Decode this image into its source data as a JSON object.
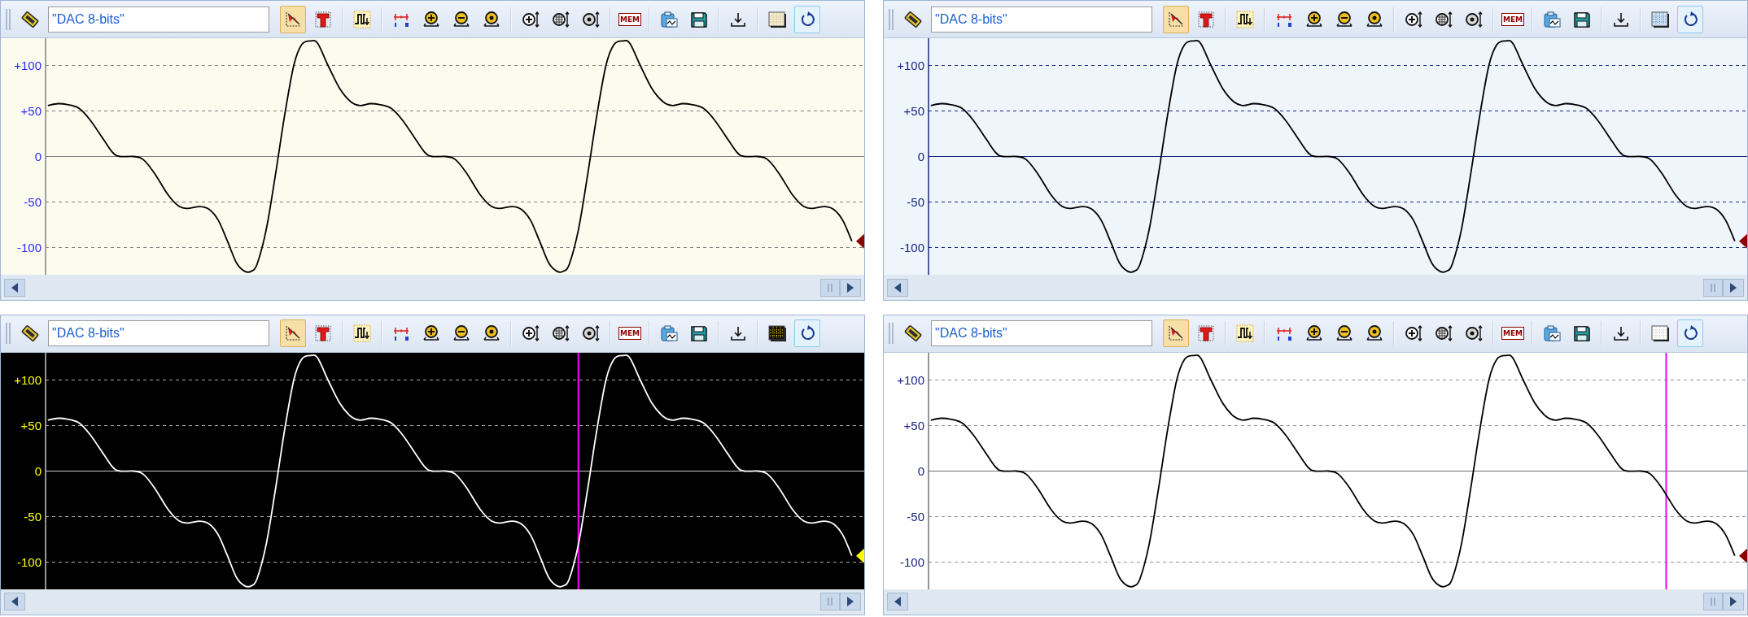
{
  "panels": [
    {
      "kind": "cream",
      "signal_name": "\"DAC 8-bits\"",
      "cursor": false,
      "y_labels": [
        "+100",
        "+50",
        "0",
        "-50",
        "-100"
      ],
      "toolbar": [
        {
          "kind": "trace",
          "pressed": true,
          "focused": false
        },
        {
          "kind": "text",
          "pressed": false,
          "focused": false
        },
        {
          "kind": "separator"
        },
        {
          "kind": "wave",
          "pressed": false,
          "focused": false
        },
        {
          "kind": "separator"
        },
        {
          "kind": "ruler",
          "pressed": false,
          "focused": false
        },
        {
          "kind": "zoom-in",
          "pressed": false,
          "focused": false
        },
        {
          "kind": "zoom-out",
          "pressed": false,
          "focused": false
        },
        {
          "kind": "zoom-fit",
          "pressed": false,
          "focused": false
        },
        {
          "kind": "separator"
        },
        {
          "kind": "vzoom-in",
          "pressed": false,
          "focused": false
        },
        {
          "kind": "vzoom-grid",
          "pressed": false,
          "focused": false
        },
        {
          "kind": "vzoom-fit",
          "pressed": false,
          "focused": false
        },
        {
          "kind": "separator"
        },
        {
          "kind": "memory",
          "label": "MEM",
          "pressed": false,
          "focused": false
        },
        {
          "kind": "separator"
        },
        {
          "kind": "clipboard",
          "pressed": false,
          "focused": false
        },
        {
          "kind": "save",
          "pressed": false,
          "focused": false
        },
        {
          "kind": "separator"
        },
        {
          "kind": "export",
          "pressed": false,
          "focused": false
        },
        {
          "kind": "separator"
        },
        {
          "kind": "grid",
          "pressed": false,
          "focused": false
        },
        {
          "kind": "reload",
          "pressed": false,
          "focused": true
        }
      ]
    },
    {
      "kind": "blue",
      "signal_name": "\"DAC 8-bits\"",
      "cursor": false,
      "y_labels": [
        "+100",
        "+50",
        "0",
        "-50",
        "-100"
      ],
      "toolbar": [
        {
          "kind": "trace",
          "pressed": true,
          "focused": false
        },
        {
          "kind": "text",
          "pressed": false,
          "focused": false
        },
        {
          "kind": "separator"
        },
        {
          "kind": "wave",
          "pressed": false,
          "focused": false
        },
        {
          "kind": "separator"
        },
        {
          "kind": "ruler",
          "pressed": false,
          "focused": false
        },
        {
          "kind": "zoom-in",
          "pressed": false,
          "focused": false
        },
        {
          "kind": "zoom-out",
          "pressed": false,
          "focused": false
        },
        {
          "kind": "zoom-fit",
          "pressed": false,
          "focused": false
        },
        {
          "kind": "separator"
        },
        {
          "kind": "vzoom-in",
          "pressed": false,
          "focused": false
        },
        {
          "kind": "vzoom-grid",
          "pressed": false,
          "focused": false
        },
        {
          "kind": "vzoom-fit",
          "pressed": false,
          "focused": false
        },
        {
          "kind": "separator"
        },
        {
          "kind": "memory",
          "label": "MEM",
          "pressed": false,
          "focused": false
        },
        {
          "kind": "separator"
        },
        {
          "kind": "clipboard",
          "pressed": false,
          "focused": false
        },
        {
          "kind": "save",
          "pressed": false,
          "focused": false
        },
        {
          "kind": "separator"
        },
        {
          "kind": "export",
          "pressed": false,
          "focused": false
        },
        {
          "kind": "separator"
        },
        {
          "kind": "grid",
          "pressed": false,
          "focused": false
        },
        {
          "kind": "reload",
          "pressed": false,
          "focused": true
        }
      ]
    },
    {
      "kind": "dark",
      "signal_name": "\"DAC 8-bits\"",
      "cursor": true,
      "y_labels": [
        "+100",
        "+50",
        "0",
        "-50",
        "-100"
      ],
      "toolbar": [
        {
          "kind": "trace",
          "pressed": true,
          "focused": false
        },
        {
          "kind": "text",
          "pressed": false,
          "focused": false
        },
        {
          "kind": "separator"
        },
        {
          "kind": "wave",
          "pressed": false,
          "focused": false
        },
        {
          "kind": "separator"
        },
        {
          "kind": "ruler",
          "pressed": false,
          "focused": false
        },
        {
          "kind": "zoom-in",
          "pressed": false,
          "focused": false
        },
        {
          "kind": "zoom-out",
          "pressed": false,
          "focused": false
        },
        {
          "kind": "zoom-fit",
          "pressed": false,
          "focused": false
        },
        {
          "kind": "separator"
        },
        {
          "kind": "vzoom-in",
          "pressed": false,
          "focused": false
        },
        {
          "kind": "vzoom-grid",
          "pressed": false,
          "focused": false
        },
        {
          "kind": "vzoom-fit",
          "pressed": false,
          "focused": false
        },
        {
          "kind": "separator"
        },
        {
          "kind": "memory",
          "label": "MEM",
          "pressed": false,
          "focused": false
        },
        {
          "kind": "separator"
        },
        {
          "kind": "clipboard",
          "pressed": false,
          "focused": false
        },
        {
          "kind": "save",
          "pressed": false,
          "focused": false
        },
        {
          "kind": "separator"
        },
        {
          "kind": "export",
          "pressed": false,
          "focused": false
        },
        {
          "kind": "separator"
        },
        {
          "kind": "grid",
          "pressed": false,
          "focused": false
        },
        {
          "kind": "reload",
          "pressed": false,
          "focused": true
        }
      ]
    },
    {
      "kind": "white",
      "signal_name": "\"DAC 8-bits\"",
      "cursor": true,
      "y_labels": [
        "+100",
        "+50",
        "0",
        "-50",
        "-100"
      ],
      "toolbar": [
        {
          "kind": "trace",
          "pressed": true,
          "focused": false
        },
        {
          "kind": "text",
          "pressed": false,
          "focused": false
        },
        {
          "kind": "separator"
        },
        {
          "kind": "wave",
          "pressed": false,
          "focused": false
        },
        {
          "kind": "separator"
        },
        {
          "kind": "ruler",
          "pressed": false,
          "focused": false
        },
        {
          "kind": "zoom-in",
          "pressed": false,
          "focused": false
        },
        {
          "kind": "zoom-out",
          "pressed": false,
          "focused": false
        },
        {
          "kind": "zoom-fit",
          "pressed": false,
          "focused": false
        },
        {
          "kind": "separator"
        },
        {
          "kind": "vzoom-in",
          "pressed": false,
          "focused": false
        },
        {
          "kind": "vzoom-grid",
          "pressed": false,
          "focused": false
        },
        {
          "kind": "vzoom-fit",
          "pressed": false,
          "focused": false
        },
        {
          "kind": "separator"
        },
        {
          "kind": "memory",
          "label": "MEM",
          "pressed": false,
          "focused": false
        },
        {
          "kind": "separator"
        },
        {
          "kind": "clipboard",
          "pressed": false,
          "focused": false
        },
        {
          "kind": "save",
          "pressed": false,
          "focused": false
        },
        {
          "kind": "separator"
        },
        {
          "kind": "export",
          "pressed": false,
          "focused": false
        },
        {
          "kind": "separator"
        },
        {
          "kind": "grid",
          "pressed": false,
          "focused": false
        },
        {
          "kind": "reload",
          "pressed": false,
          "focused": true
        }
      ]
    }
  ]
}
